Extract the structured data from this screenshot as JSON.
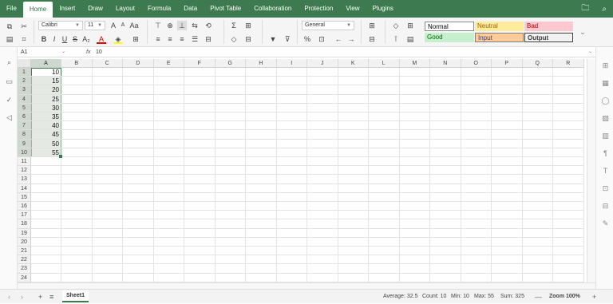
{
  "menu": {
    "items": [
      "File",
      "Home",
      "Insert",
      "Draw",
      "Layout",
      "Formula",
      "Data",
      "Pivot Table",
      "Collaboration",
      "Protection",
      "View",
      "Plugins"
    ],
    "active": "Home"
  },
  "toolbar": {
    "font_name": "Calibri",
    "font_size": "11",
    "number_format": "General"
  },
  "styles": {
    "normal": "Normal",
    "neutral": "Neutral",
    "bad": "Bad",
    "good": "Good",
    "input": "Input",
    "output": "Output"
  },
  "formula_bar": {
    "cell_ref": "A1",
    "fx": "fx",
    "value": "10"
  },
  "grid": {
    "columns": [
      "A",
      "B",
      "C",
      "D",
      "E",
      "F",
      "G",
      "H",
      "I",
      "J",
      "K",
      "L",
      "M",
      "N",
      "O",
      "P",
      "Q",
      "R"
    ],
    "rows": [
      "1",
      "2",
      "3",
      "4",
      "5",
      "6",
      "7",
      "8",
      "9",
      "10",
      "11",
      "12",
      "13",
      "14",
      "15",
      "16",
      "17",
      "18",
      "19",
      "20",
      "21",
      "22",
      "23",
      "24"
    ],
    "column_a_values": [
      "10",
      "15",
      "20",
      "25",
      "30",
      "35",
      "40",
      "45",
      "50",
      "55"
    ]
  },
  "sheet": {
    "tab_label": "Sheet1"
  },
  "status": {
    "average": "Average: 32.5",
    "count": "Count: 10",
    "min": "Min: 10",
    "max": "Max: 55",
    "sum": "Sum: 325",
    "zoom": "Zoom 100%"
  },
  "colors": {
    "accent": "#3d7a4f",
    "neutral_bg": "#ffeb9c",
    "bad_bg": "#ffc7ce",
    "good_bg": "#c6efce",
    "input_bg": "#ffcc99",
    "selection": "#cfd8cf"
  }
}
